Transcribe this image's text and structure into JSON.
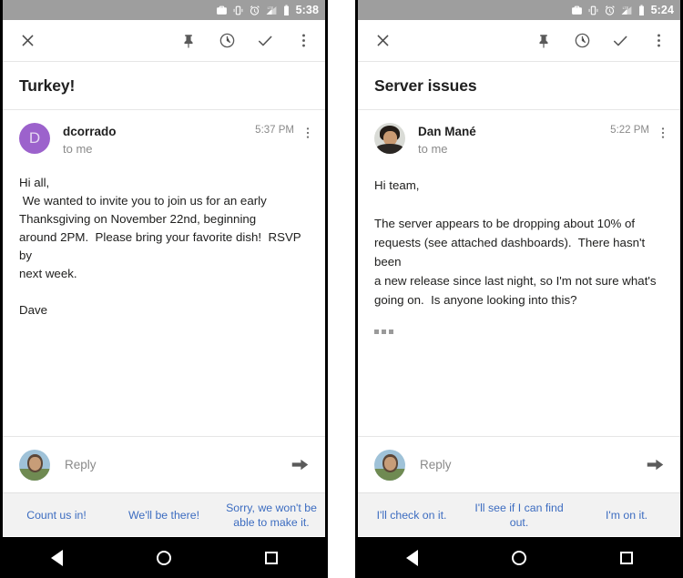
{
  "panels": [
    {
      "id": "left",
      "status": {
        "time": "5:38",
        "icons": [
          "briefcase-icon",
          "vibrate-icon",
          "alarm-icon",
          "signal-icon",
          "battery-icon"
        ]
      },
      "toolbar": {
        "close_label": "close-icon",
        "pin_label": "pin-icon",
        "snooze_label": "clock-icon",
        "done_label": "check-icon",
        "overflow_label": "more-vertical-icon"
      },
      "subject": "Turkey!",
      "message": {
        "sender": "dcorrado",
        "recipient": "to me",
        "time": "5:37 PM",
        "avatar_type": "initial",
        "avatar_initial": "D",
        "avatar_color": "#9c62cc",
        "body": "Hi all,\n We wanted to invite you to join us for an early\nThanksgiving on November 22nd, beginning\naround 2PM.  Please bring your favorite dish!  RSVP by\nnext week.\n\nDave",
        "has_trim_toggle": false
      },
      "reply": {
        "placeholder": "Reply",
        "send_label": "send-icon"
      },
      "smart_replies": [
        "Count us in!",
        "We'll be there!",
        "Sorry, we won't be able to make it."
      ],
      "nav": [
        "back-button",
        "home-button",
        "recents-button"
      ]
    },
    {
      "id": "right",
      "status": {
        "time": "5:24",
        "icons": [
          "briefcase-icon",
          "vibrate-icon",
          "alarm-icon",
          "signal-icon",
          "battery-icon"
        ]
      },
      "toolbar": {
        "close_label": "close-icon",
        "pin_label": "pin-icon",
        "snooze_label": "clock-icon",
        "done_label": "check-icon",
        "overflow_label": "more-vertical-icon"
      },
      "subject": "Server issues",
      "message": {
        "sender": "Dan Mané",
        "recipient": "to me",
        "time": "5:22 PM",
        "avatar_type": "photo",
        "avatar_initial": "",
        "avatar_color": "#d9dbd6",
        "body": "Hi team,\n\nThe server appears to be dropping about 10% of\nrequests (see attached dashboards).  There hasn't been\na new release since last night, so I'm not sure what's\ngoing on.  Is anyone looking into this?",
        "has_trim_toggle": true
      },
      "reply": {
        "placeholder": "Reply",
        "send_label": "send-icon"
      },
      "smart_replies": [
        "I'll check on it.",
        "I'll see if I can find out.",
        "I'm on it."
      ],
      "nav": [
        "back-button",
        "home-button",
        "recents-button"
      ]
    }
  ],
  "colors": {
    "status_bar": "#9e9e9e",
    "accent_blue": "#3c6cc0",
    "avatar_purple": "#9c62cc",
    "smart_reply_bg": "#f2f2f2"
  }
}
